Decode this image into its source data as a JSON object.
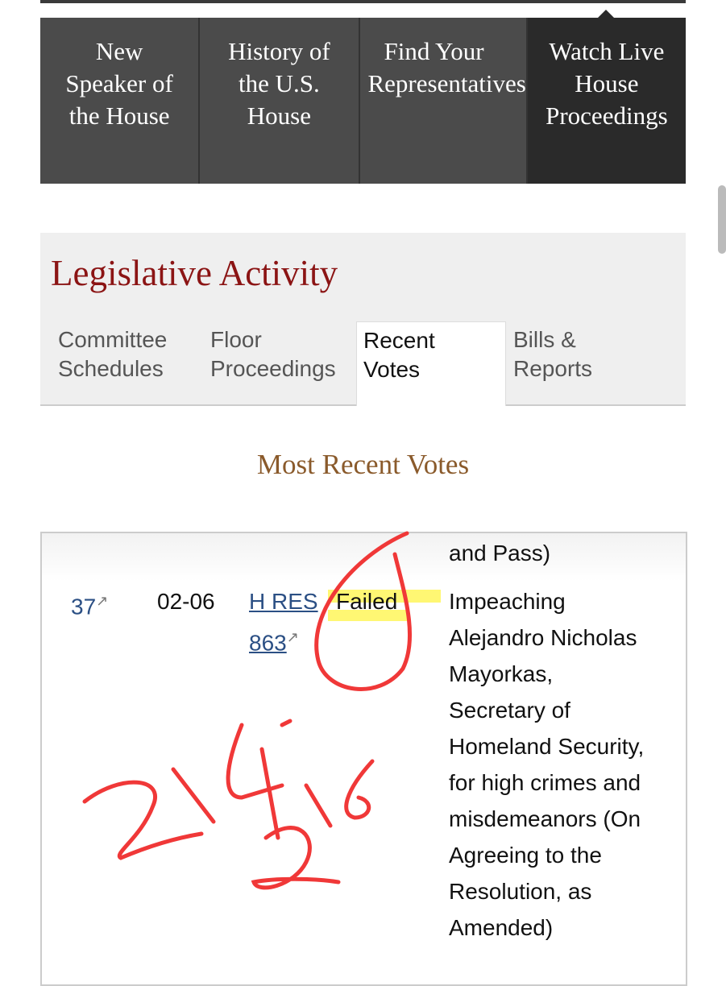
{
  "nav": {
    "tiles": [
      {
        "lines": [
          "New",
          "Speaker of",
          "the House"
        ]
      },
      {
        "lines": [
          "History of",
          "the U.S.",
          "House"
        ]
      },
      {
        "lines": [
          "Find Your",
          "Representatives"
        ]
      },
      {
        "lines": [
          "Watch Live",
          "House",
          "Proceedings"
        ]
      }
    ]
  },
  "legislative": {
    "title": "Legislative Activity",
    "tabs": [
      {
        "lines": [
          "Committee",
          "Schedules"
        ]
      },
      {
        "lines": [
          "Floor",
          "Proceedings"
        ]
      },
      {
        "lines": [
          "Recent",
          "Votes"
        ],
        "active": true
      },
      {
        "lines": [
          "Bills &",
          "Reports"
        ]
      }
    ]
  },
  "votes": {
    "heading": "Most Recent Votes",
    "prev_tail": "and Pass)",
    "row": {
      "roll": "37",
      "date": "02-06",
      "bill_line1": "H RES",
      "bill_line2": "863",
      "result": "Failed",
      "description": [
        "Impeaching",
        "Alejandro Nicholas",
        "Mayorkas,",
        "Secretary of",
        "Homeland Security,",
        "for high crimes and",
        "misdemeanors (On",
        "Agreeing to the",
        "Resolution, as",
        "Amended)"
      ]
    }
  },
  "annotation": {
    "handwritten": "214-216",
    "color": "#f03030",
    "highlight": "#fff000"
  }
}
